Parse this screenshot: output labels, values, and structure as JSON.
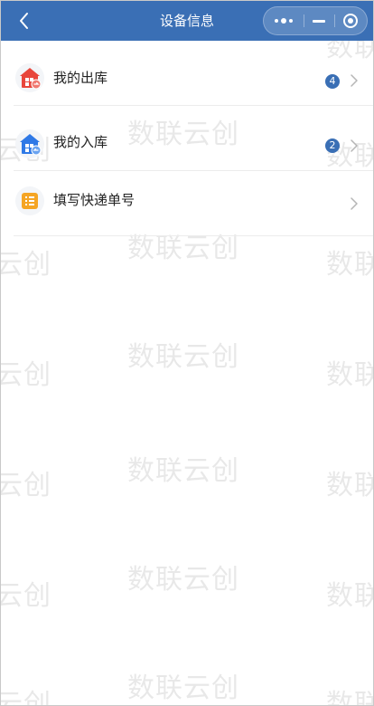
{
  "navbar": {
    "title": "设备信息",
    "back_icon": "chevron-left-icon",
    "more_icon": "more-dots-icon",
    "minimize_icon": "minimize-icon",
    "close_icon": "target-circle-icon",
    "background": "#3a6fb5"
  },
  "menu": {
    "items": [
      {
        "label": "我的出库",
        "badge": "4",
        "icon": "outbound-house-icon",
        "icon_color": "#e8463c"
      },
      {
        "label": "我的入库",
        "badge": "2",
        "icon": "inbound-house-icon",
        "icon_color": "#2f79e6"
      },
      {
        "label": "填写快递单号",
        "badge": "",
        "icon": "list-form-icon",
        "icon_color": "#f5a524"
      }
    ]
  },
  "watermark": {
    "text": "数联云创",
    "fragment_left": "云创",
    "fragment_right": "数联"
  }
}
